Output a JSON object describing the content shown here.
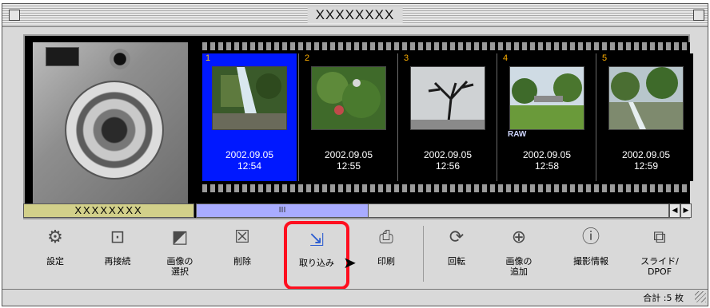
{
  "window": {
    "title": "XXXXXXXX"
  },
  "filmstrip": {
    "frames": [
      {
        "number": "1",
        "date": "2002.09.05",
        "time": "12:54",
        "selected": true,
        "raw": ""
      },
      {
        "number": "2",
        "date": "2002.09.05",
        "time": "12:55",
        "selected": false,
        "raw": ""
      },
      {
        "number": "3",
        "date": "2002.09.05",
        "time": "12:56",
        "selected": false,
        "raw": ""
      },
      {
        "number": "4",
        "date": "2002.09.05",
        "time": "12:58",
        "selected": false,
        "raw": "RAW"
      },
      {
        "number": "5",
        "date": "2002.09.05",
        "time": "12:59",
        "selected": false,
        "raw": ""
      }
    ]
  },
  "label_bar": {
    "text": "XXXXXXXX"
  },
  "scroll": {
    "thumb_label": "III",
    "left_arrow": "◀",
    "right_arrow": "▶",
    "position": 0.0
  },
  "toolbar": {
    "tools": [
      {
        "label": "設定",
        "icon": "settings-icon"
      },
      {
        "label": "再接続",
        "icon": "reconnect-icon"
      },
      {
        "label": "画像の\n選択",
        "icon": "select-image-icon"
      },
      {
        "label": "削除",
        "icon": "delete-icon"
      },
      {
        "label": "取り込み",
        "icon": "import-icon"
      },
      {
        "label": "印刷",
        "icon": "print-icon"
      },
      {
        "label": "回転",
        "icon": "rotate-icon"
      },
      {
        "label": "画像の\n追加",
        "icon": "add-image-icon"
      },
      {
        "label": "撮影情報",
        "icon": "shooting-info-icon"
      },
      {
        "label": "スライド/\nDPOF",
        "icon": "slideshow-dpof-icon"
      }
    ]
  },
  "status": {
    "total": "合計 :5 枚"
  },
  "colors": {
    "selected_frame": "#0018ff",
    "highlight": "#ff0f1f",
    "label_bar": "#d2d08a",
    "scroll_thumb": "#a9acff"
  }
}
